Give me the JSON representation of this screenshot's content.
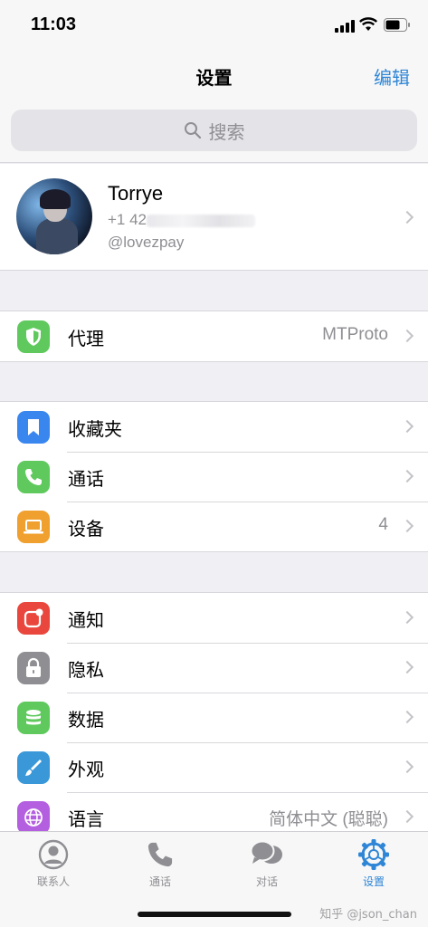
{
  "status_bar": {
    "time": "11:03"
  },
  "nav": {
    "title": "设置",
    "edit_label": "编辑"
  },
  "search": {
    "placeholder": "搜索"
  },
  "profile": {
    "name": "Torrye",
    "phone_prefix": "+1 42",
    "username": "@lovezpay"
  },
  "groups": {
    "proxy": {
      "label": "代理",
      "value": "MTProto",
      "icon": "shield-icon",
      "color": "#5fc95e"
    },
    "saved": {
      "label": "收藏夹",
      "icon": "bookmark-icon",
      "color": "#3a86ef"
    },
    "calls": {
      "label": "通话",
      "icon": "phone-icon",
      "color": "#5fc95e"
    },
    "devices": {
      "label": "设备",
      "value": "4",
      "icon": "laptop-icon",
      "color": "#f0a02f"
    },
    "notifications": {
      "label": "通知",
      "icon": "notification-icon",
      "color": "#e9473d"
    },
    "privacy": {
      "label": "隐私",
      "icon": "lock-icon",
      "color": "#8e8e93"
    },
    "data": {
      "label": "数据",
      "icon": "database-icon",
      "color": "#5fc95e"
    },
    "appearance": {
      "label": "外观",
      "icon": "brush-icon",
      "color": "#3a98d8"
    },
    "language": {
      "label": "语言",
      "value": "简体中文 (聪聪)",
      "icon": "globe-icon",
      "color": "#b35fe0"
    }
  },
  "tabs": [
    {
      "label": "联系人",
      "icon": "person-icon",
      "active": false
    },
    {
      "label": "通话",
      "icon": "phone-icon",
      "active": false
    },
    {
      "label": "对话",
      "icon": "chat-bubbles-icon",
      "active": false
    },
    {
      "label": "设置",
      "icon": "gear-icon",
      "active": true
    }
  ],
  "watermark": "知乎 @json_chan",
  "colors": {
    "accent": "#2f86d6",
    "background": "#efeff4"
  }
}
